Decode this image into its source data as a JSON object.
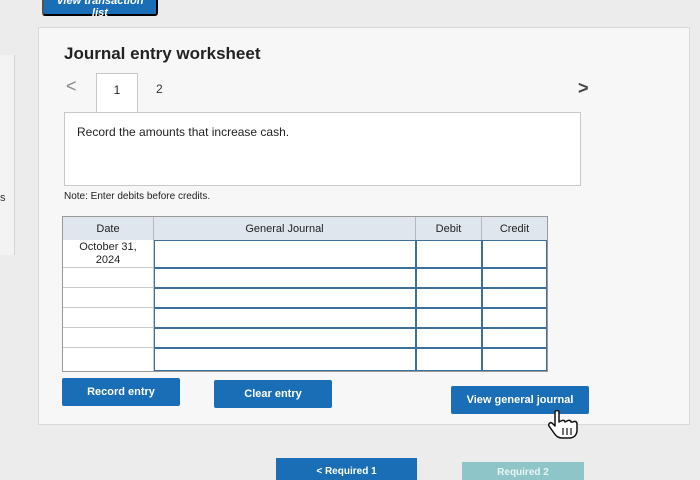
{
  "top_button": {
    "label": "View transaction list"
  },
  "worksheet": {
    "title": "Journal entry worksheet",
    "tabs": [
      {
        "label": "1"
      },
      {
        "label": "2"
      }
    ],
    "nav_prev": "<",
    "nav_next": ">",
    "instruction": "Record the amounts that increase cash.",
    "note": "Note: Enter debits before credits."
  },
  "journal": {
    "headers": {
      "date": "Date",
      "account": "General Journal",
      "debit": "Debit",
      "credit": "Credit"
    },
    "rows": [
      {
        "date": "October 31, 2024",
        "account": "",
        "debit": "",
        "credit": ""
      },
      {
        "date": "",
        "account": "",
        "debit": "",
        "credit": ""
      },
      {
        "date": "",
        "account": "",
        "debit": "",
        "credit": ""
      },
      {
        "date": "",
        "account": "",
        "debit": "",
        "credit": ""
      },
      {
        "date": "",
        "account": "",
        "debit": "",
        "credit": ""
      },
      {
        "date": "",
        "account": "",
        "debit": "",
        "credit": ""
      }
    ]
  },
  "buttons": {
    "record": "Record entry",
    "clear": "Clear entry",
    "view_journal": "View general journal"
  },
  "bottom_nav": {
    "prev": "< Required 1",
    "next": "Required 2"
  },
  "left_edge_char": "s",
  "colors": {
    "primary": "#1a6eb5",
    "header_bg": "#dfe6ee",
    "input_border": "#3c6f9a"
  }
}
